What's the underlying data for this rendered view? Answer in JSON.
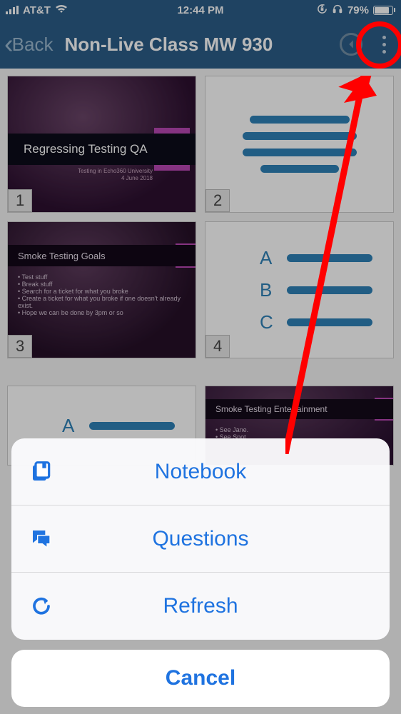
{
  "status": {
    "carrier": "AT&T",
    "time": "12:44 PM",
    "battery": "79%"
  },
  "nav": {
    "back_label": "Back",
    "title": "Non-Live Class MW 930"
  },
  "slides": {
    "s1": {
      "num": "1",
      "title": "Regressing Testing QA",
      "sub1": "Testing in Echo360 University",
      "sub2": "4 June 2018"
    },
    "s2": {
      "num": "2"
    },
    "s3": {
      "num": "3",
      "title": "Smoke Testing Goals",
      "b1": "Test stuff",
      "b2": "Break stuff",
      "b3": "Search for a ticket for what you broke",
      "b4": "Create a ticket for what you broke if one doesn't already exist.",
      "b5": "Hope we can be done by 3pm or so"
    },
    "s4": {
      "num": "4",
      "a": "A",
      "b": "B",
      "c": "C"
    },
    "s5": {
      "a": "A"
    },
    "s6": {
      "title": "Smoke Testing Entertainment",
      "b1": "See Jane.",
      "b2": "See Spot."
    }
  },
  "sheet": {
    "notebook": "Notebook",
    "questions": "Questions",
    "refresh": "Refresh",
    "cancel": "Cancel"
  }
}
